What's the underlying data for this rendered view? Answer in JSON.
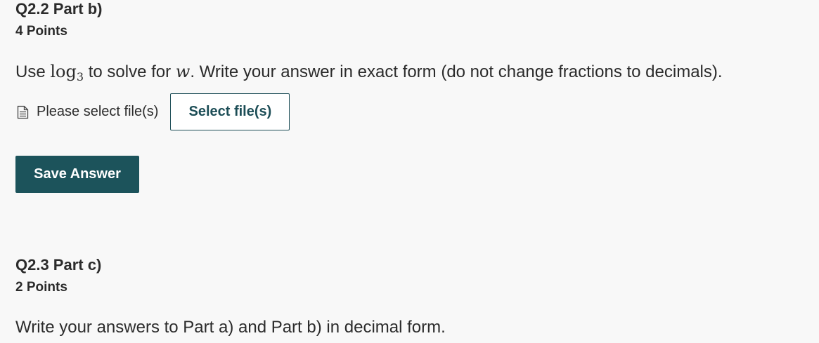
{
  "q22": {
    "title": "Q2.2 Part b)",
    "points": "4 Points",
    "prompt_before": "Use ",
    "math_log": "log",
    "math_base": "3",
    "prompt_middle": " to solve for ",
    "math_var": "w",
    "prompt_after": ".  Write your answer in exact form (do not change fractions to decimals).",
    "upload": {
      "icon": "file-icon",
      "status_text": "Please select file(s)",
      "button_label": "Select file(s)"
    },
    "save_label": "Save Answer"
  },
  "q23": {
    "title": "Q2.3 Part c)",
    "points": "2 Points",
    "prompt": "Write your answers to Part a) and Part b) in decimal form."
  },
  "colors": {
    "background": "#f8f8f8",
    "text": "#2b2b2b",
    "accent": "#1c535b"
  }
}
